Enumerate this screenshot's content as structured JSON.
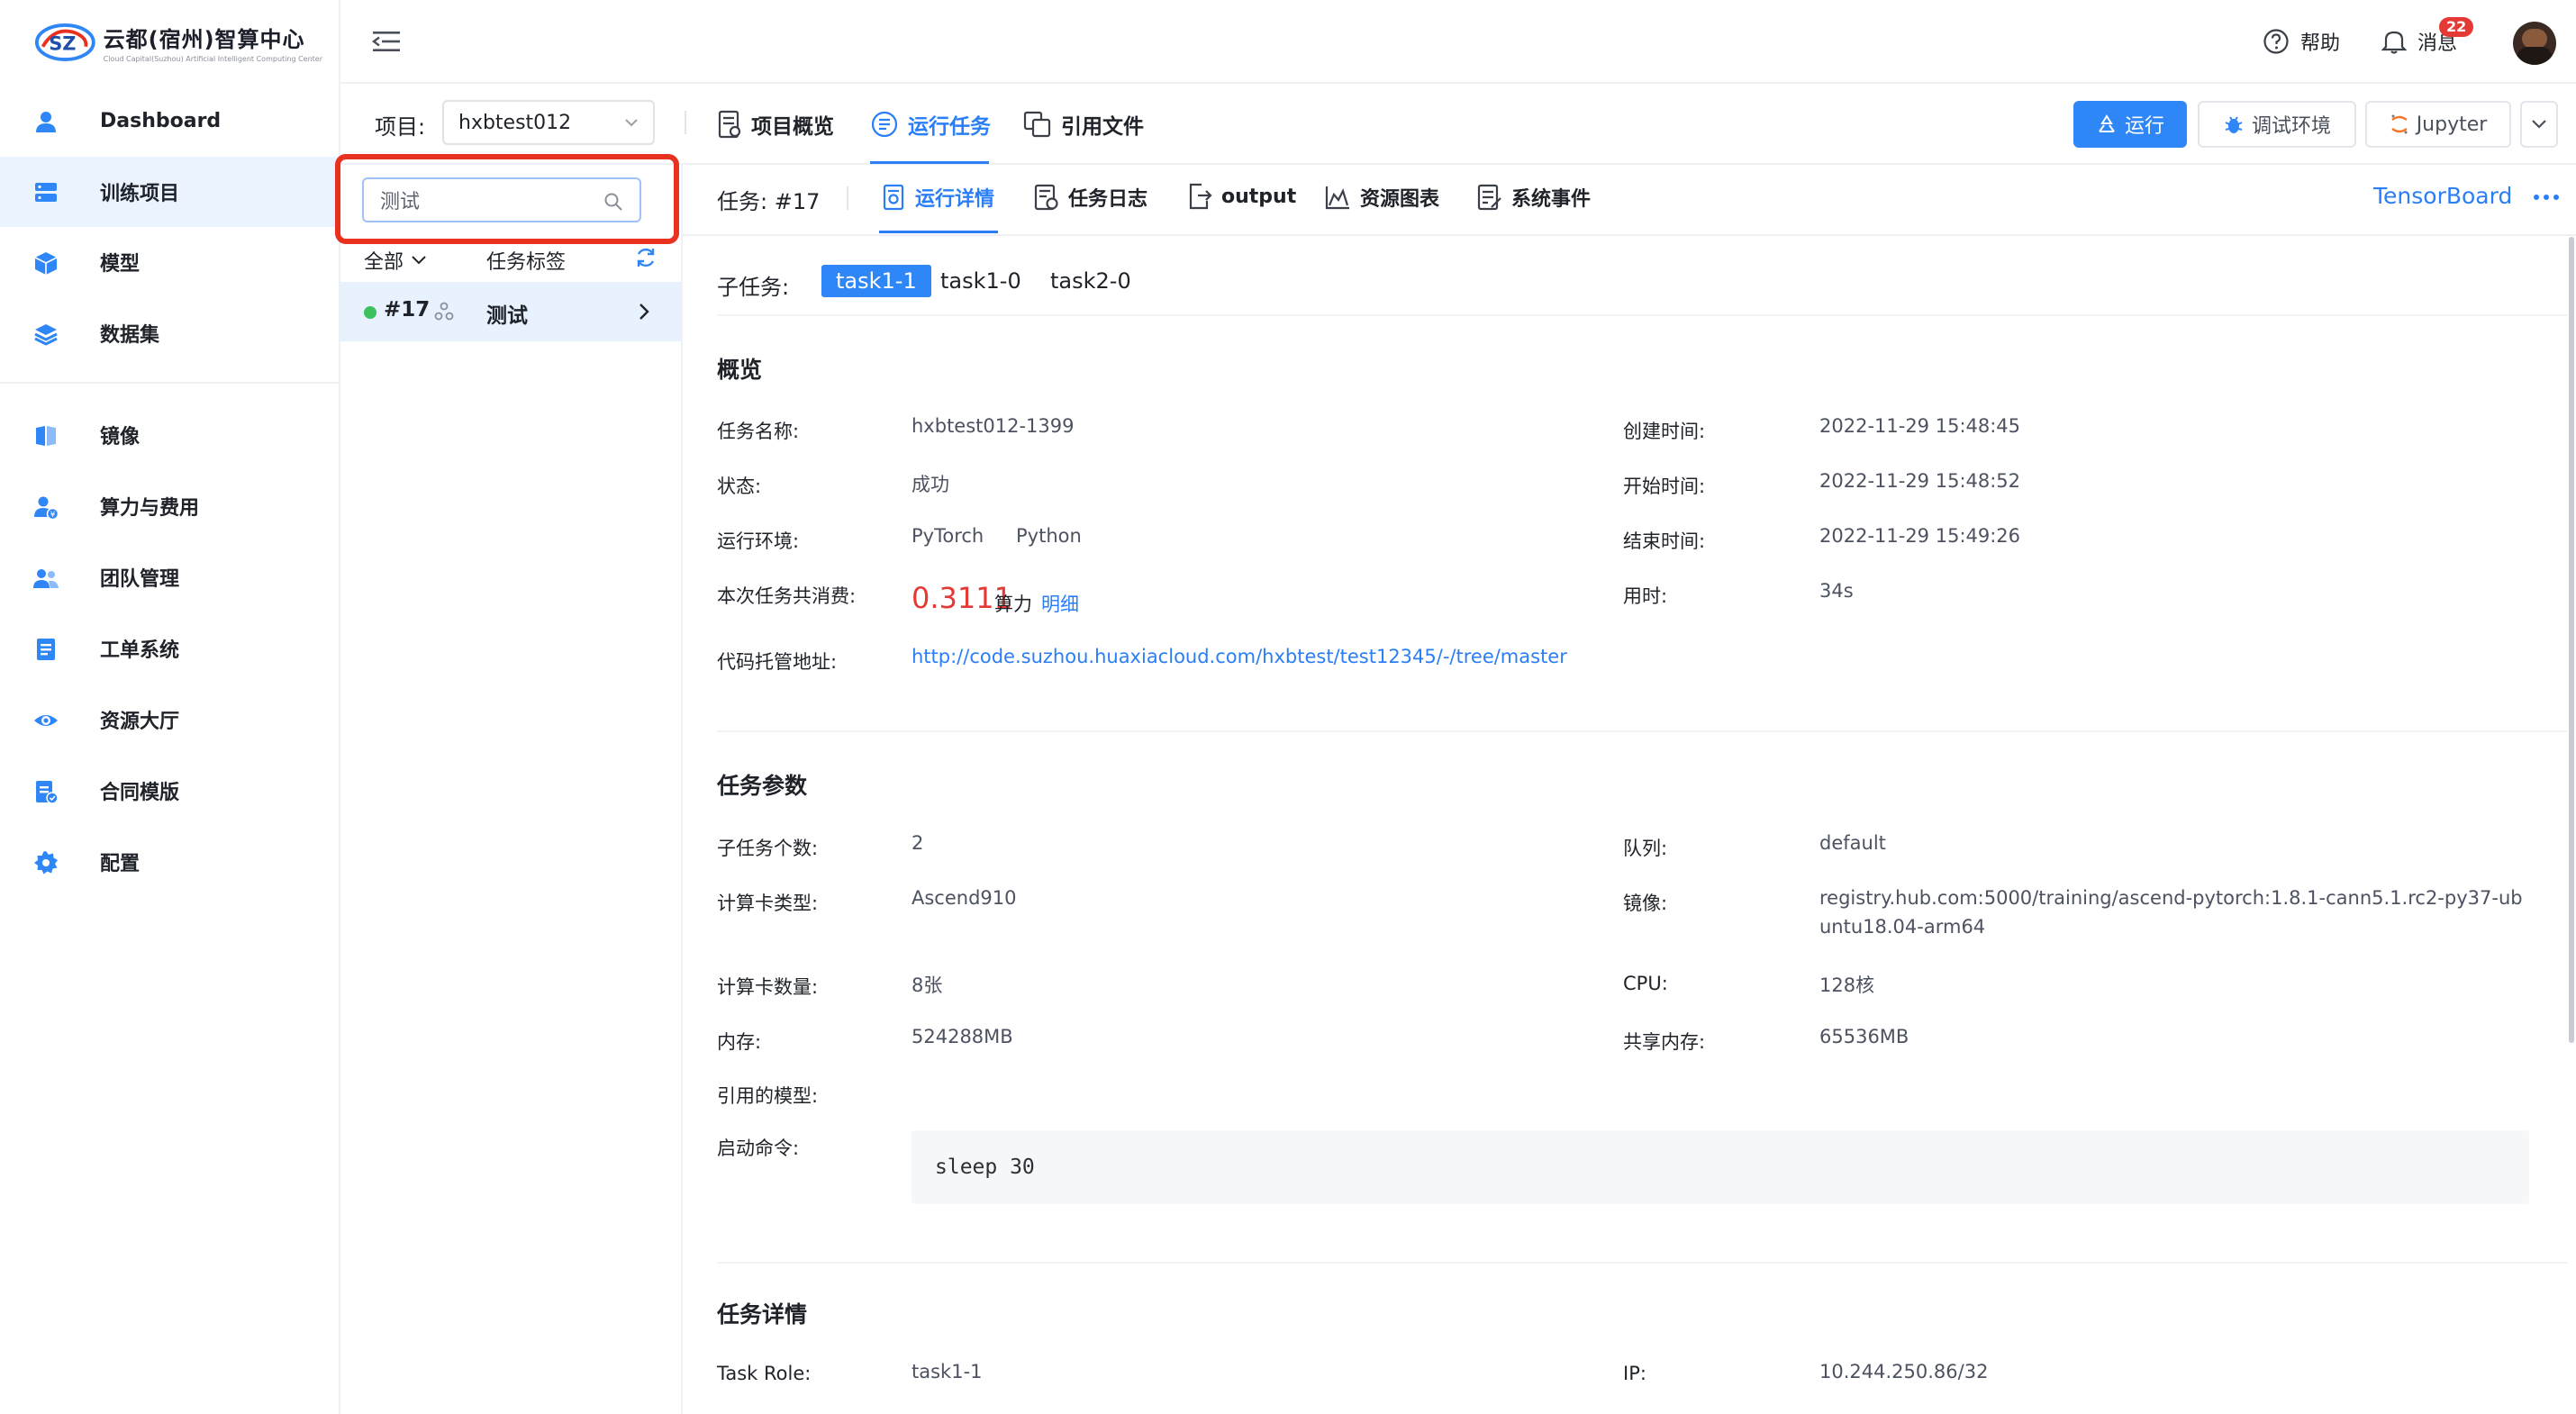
{
  "brand": {
    "title": "云都(宿州)智算中心",
    "subtitle": "Cloud Capital(Suzhou) Artificial Intelligent Computing Center"
  },
  "sidebar": {
    "items": [
      {
        "label": "Dashboard",
        "icon": "user-icon"
      },
      {
        "label": "训练项目",
        "icon": "server-icon",
        "active": true
      },
      {
        "label": "模型",
        "icon": "cube-icon"
      },
      {
        "label": "数据集",
        "icon": "layers-icon"
      },
      {
        "label": "镜像",
        "icon": "book-icon"
      },
      {
        "label": "算力与费用",
        "icon": "user-cost-icon"
      },
      {
        "label": "团队管理",
        "icon": "team-icon"
      },
      {
        "label": "工单系统",
        "icon": "document-icon"
      },
      {
        "label": "资源大厅",
        "icon": "eye-icon"
      },
      {
        "label": "合同模版",
        "icon": "contract-icon"
      },
      {
        "label": "配置",
        "icon": "gear-icon"
      }
    ]
  },
  "header": {
    "help": "帮助",
    "messages": "消息",
    "message_count": "22"
  },
  "projbar": {
    "label": "项目:",
    "project": "hxbtest012",
    "nav": [
      "项目概览",
      "运行任务",
      "引用文件"
    ],
    "run": "运行",
    "debug": "调试环境",
    "jupyter": "Jupyter"
  },
  "tasklist": {
    "search_value": "测试",
    "filter": "全部",
    "tag_col": "任务标签",
    "rows": [
      {
        "id": "#17",
        "tag": "测试",
        "status_color": "#3cc15e"
      }
    ]
  },
  "content": {
    "task_label": "任务: #17",
    "tabs": [
      "运行详情",
      "任务日志",
      "output",
      "资源图表",
      "系统事件"
    ],
    "tensorboard": "TensorBoard",
    "subtask_label": "子任务:",
    "subtasks": [
      "task1-1",
      "task1-0",
      "task2-0"
    ],
    "overview": {
      "title": "概览",
      "name_k": "任务名称:",
      "name_v": "hxbtest012-1399",
      "created_k": "创建时间:",
      "created_v": "2022-11-29 15:48:45",
      "status_k": "状态:",
      "status_v": "成功",
      "start_k": "开始时间:",
      "start_v": "2022-11-29 15:48:52",
      "env_k": "运行环境:",
      "env_v1": "PyTorch",
      "env_v2": "Python",
      "end_k": "结束时间:",
      "end_v": "2022-11-29 15:49:26",
      "cost_k": "本次任务共消费:",
      "cost_v": "0.3111",
      "cost_unit": "算力",
      "cost_link": "明细",
      "duration_k": "用时:",
      "duration_v": "34s",
      "repo_k": "代码托管地址:",
      "repo_v": "http://code.suzhou.huaxiacloud.com/hxbtest/test12345/-/tree/master"
    },
    "params": {
      "title": "任务参数",
      "subcount_k": "子任务个数:",
      "subcount_v": "2",
      "queue_k": "队列:",
      "queue_v": "default",
      "cardtype_k": "计算卡类型:",
      "cardtype_v": "Ascend910",
      "image_k": "镜像:",
      "image_v1": "registry.hub.com:5000/training/ascend-pytorch:1.8.1-cann5.1.rc2-py37-ub",
      "image_v2": "untu18.04-arm64",
      "cardnum_k": "计算卡数量:",
      "cardnum_v": "8张",
      "cpu_k": "CPU:",
      "cpu_v": "128核",
      "mem_k": "内存:",
      "mem_v": "524288MB",
      "shm_k": "共享内存:",
      "shm_v": "65536MB",
      "model_k": "引用的模型:",
      "cmd_k": "启动命令:",
      "cmd_v": "sleep 30"
    },
    "details": {
      "title": "任务详情",
      "role_k": "Task Role:",
      "role_v": "task1-1",
      "ip_k": "IP:",
      "ip_v": "10.244.250.86/32"
    }
  },
  "colors": {
    "primary": "#2f86f6",
    "danger": "#e53935",
    "success": "#3cc15e",
    "highlight_border": "#e8321f"
  }
}
